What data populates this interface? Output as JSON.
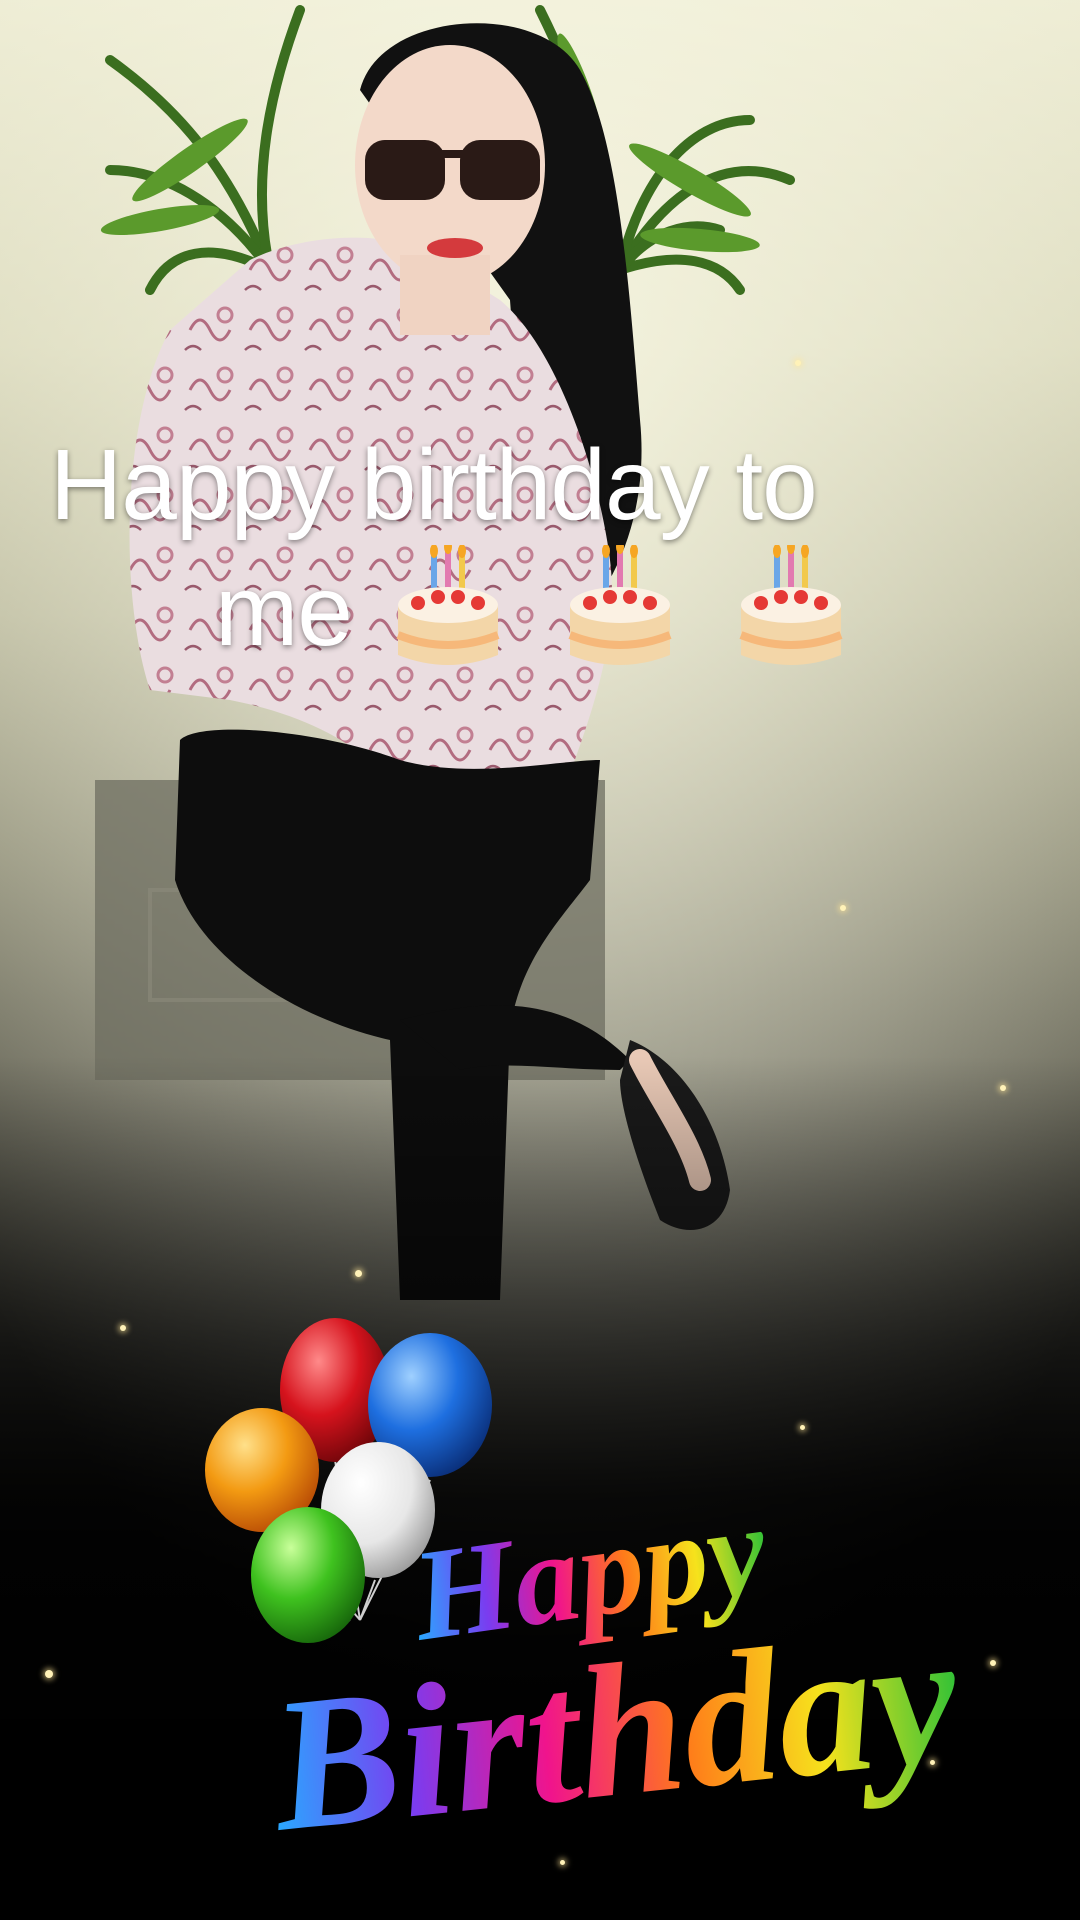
{
  "caption": {
    "line1": "Happy birthday to",
    "line2": "me"
  },
  "overlay": {
    "greeting_word1": "Happy",
    "greeting_word2": "Birthday"
  },
  "icons": [
    "birthday-cake-icon",
    "birthday-cake-icon",
    "birthday-cake-icon",
    "balloon-icon"
  ],
  "colors": {
    "caption_text": "#ffffff",
    "balloon_red": "#d6131d",
    "balloon_blue": "#1e6fe0",
    "balloon_orange": "#f39a12",
    "balloon_white": "#f2f2f2",
    "balloon_green": "#3fc21f"
  }
}
